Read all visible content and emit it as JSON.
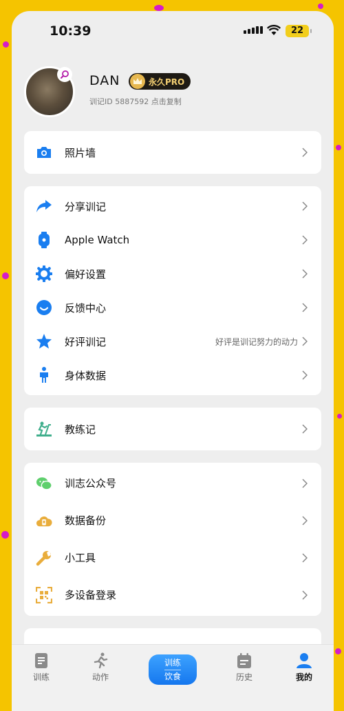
{
  "status_bar": {
    "time": "10:39",
    "battery": "22"
  },
  "profile": {
    "name": "DAN",
    "badge": "永久PRO",
    "user_id_line": "训记ID 5887592 点击复制"
  },
  "sections": [
    {
      "items": [
        {
          "label": "照片墙",
          "icon": "camera-icon"
        }
      ]
    },
    {
      "items": [
        {
          "label": "分享训记",
          "icon": "share-icon"
        },
        {
          "label": "Apple Watch",
          "icon": "watch-icon"
        },
        {
          "label": "偏好设置",
          "icon": "gear-icon"
        },
        {
          "label": "反馈中心",
          "icon": "smile-icon"
        },
        {
          "label": "好评训记",
          "icon": "star-icon",
          "hint": "好评是训记努力的动力"
        },
        {
          "label": "身体数据",
          "icon": "person-icon"
        }
      ]
    },
    {
      "items": [
        {
          "label": "教练记",
          "icon": "coach-icon"
        }
      ]
    },
    {
      "items": [
        {
          "label": "训志公众号",
          "icon": "wechat-icon"
        },
        {
          "label": "数据备份",
          "icon": "cloud-backup-icon"
        },
        {
          "label": "小工具",
          "icon": "wrench-icon"
        },
        {
          "label": "多设备登录",
          "icon": "qr-code-icon"
        }
      ]
    }
  ],
  "tabbar": {
    "tabs": [
      {
        "label": "训练",
        "icon": "clipboard-icon"
      },
      {
        "label": "动作",
        "icon": "running-icon"
      },
      {
        "label": "历史",
        "icon": "calendar-icon"
      },
      {
        "label": "我的",
        "icon": "user-icon"
      }
    ],
    "center": {
      "top": "训练",
      "bottom": "饮食"
    }
  },
  "colors": {
    "background": "#f5c400",
    "accent": "#1a7ef0",
    "badge_gold": "#f3cf72",
    "coach_teal": "#3fae8c",
    "wechat_green": "#5fcf6d",
    "backup_gold": "#e9ad3c"
  }
}
